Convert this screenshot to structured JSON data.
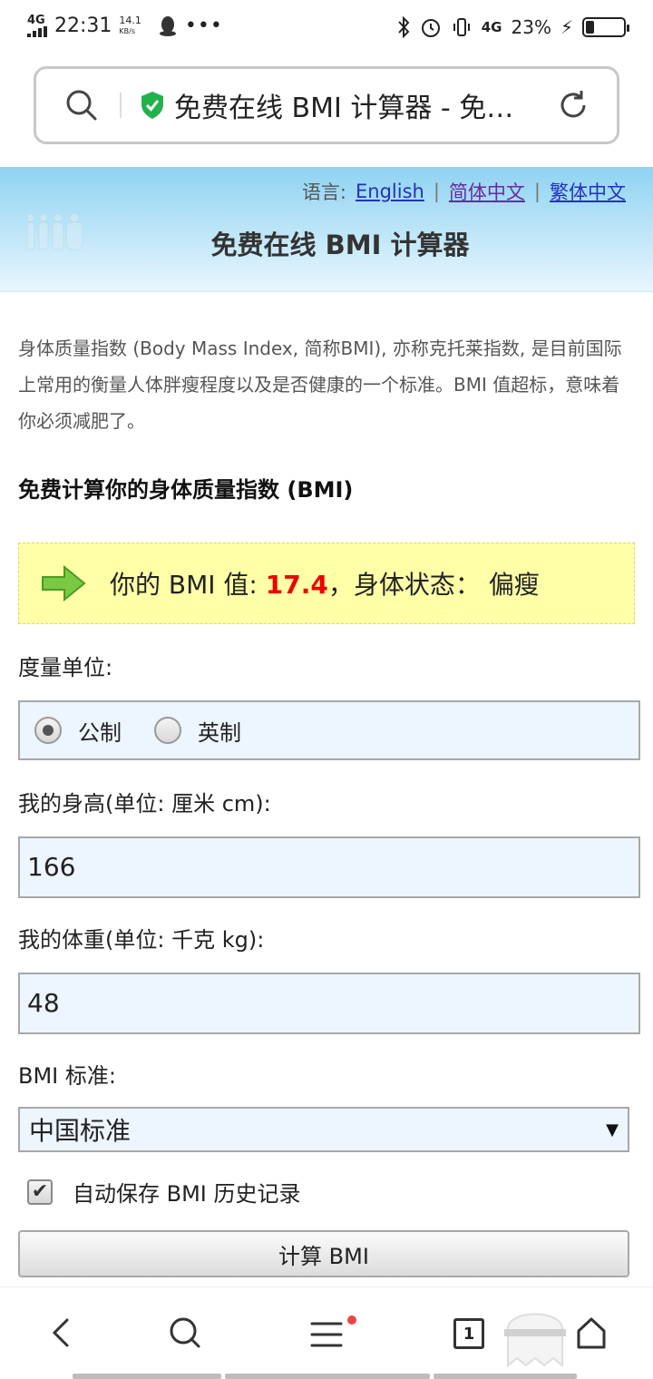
{
  "status_bar": {
    "network": "4G",
    "time": "22:31",
    "speed_value": "14.1",
    "speed_unit": "KB/s",
    "network_right": "4G",
    "battery": "23%",
    "battery_level": 0.23
  },
  "address_bar": {
    "title": "免费在线 BMI 计算器 - 免…"
  },
  "site": {
    "lang_label": "语言:",
    "lang_en": "English",
    "lang_sep": "|",
    "lang_sc": "简体中文",
    "lang_tc": "繁体中文",
    "title": "免费在线 BMI 计算器"
  },
  "content": {
    "intro": "身体质量指数 (Body Mass Index, 简称BMI), 亦称克托莱指数, 是目前国际上常用的衡量人体胖瘦程度以及是否健康的一个标准。BMI 值超标，意味着你必须减肥了。",
    "heading": "免费计算你的身体质量指数 (BMI)",
    "result_prefix": "你的 BMI 值: ",
    "result_value": "17.4",
    "result_suffix": "，身体状态： 偏瘦",
    "unit_label": "度量单位:",
    "unit_metric": "公制",
    "unit_imperial": "英制",
    "height_label": "我的身高(单位: 厘米 cm):",
    "height_value": "166",
    "weight_label": "我的体重(单位: 千克 kg):",
    "weight_value": "48",
    "standard_label": "BMI 标准:",
    "standard_value": "中国标准",
    "autosave_label": "自动保存 BMI 历史记录",
    "calc_button": "计算 BMI"
  },
  "bottom_nav": {
    "tab_count": "1"
  }
}
